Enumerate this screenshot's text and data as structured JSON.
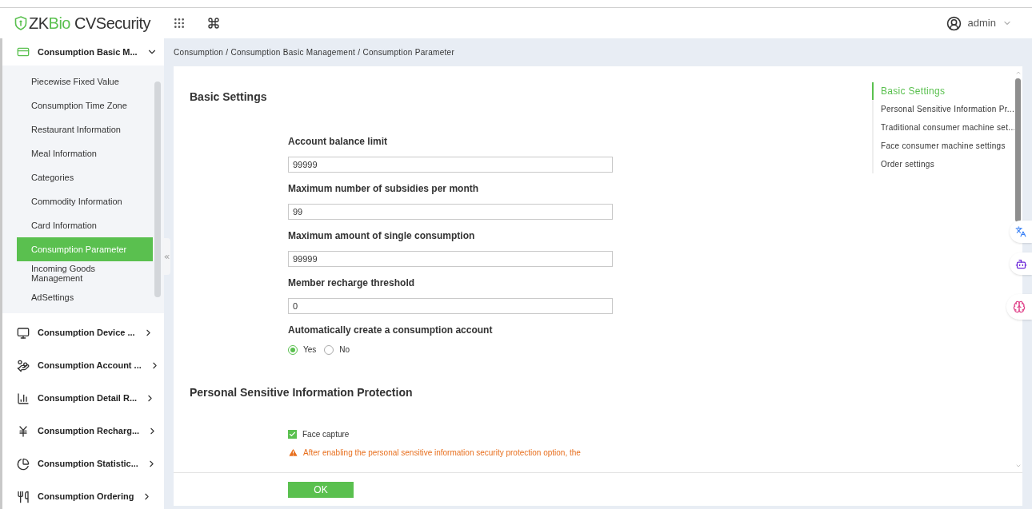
{
  "header": {
    "logo": {
      "part1": "ZK",
      "part2": "Bio",
      "part3": " CVSecurity"
    },
    "user": "admin"
  },
  "sidebar": {
    "groups": [
      {
        "label": "Consumption Basic M...",
        "expanded": true,
        "children": [
          {
            "label": "Piecewise Fixed Value",
            "selected": false
          },
          {
            "label": "Consumption Time Zone",
            "selected": false
          },
          {
            "label": "Restaurant Information",
            "selected": false
          },
          {
            "label": "Meal Information",
            "selected": false
          },
          {
            "label": "Categories",
            "selected": false
          },
          {
            "label": "Commodity Information",
            "selected": false
          },
          {
            "label": "Card Information",
            "selected": false
          },
          {
            "label": "Consumption Parameter",
            "selected": true
          },
          {
            "label": "Incoming Goods Management",
            "selected": false
          },
          {
            "label": "AdSettings",
            "selected": false
          }
        ]
      },
      {
        "label": "Consumption Device ...",
        "expanded": false
      },
      {
        "label": "Consumption Account ...",
        "expanded": false
      },
      {
        "label": "Consumption Detail R...",
        "expanded": false
      },
      {
        "label": "Consumption Recharg...",
        "expanded": false
      },
      {
        "label": "Consumption Statistic...",
        "expanded": false
      },
      {
        "label": "Consumption Ordering",
        "expanded": false
      }
    ]
  },
  "breadcrumb": "Consumption / Consumption Basic Management / Consumption Parameter",
  "sections": [
    {
      "title": "Basic Settings",
      "fields": [
        {
          "kind": "text",
          "label": "Account balance limit",
          "value": "99999"
        },
        {
          "kind": "text",
          "label": "Maximum number of subsidies per month",
          "value": "99"
        },
        {
          "kind": "text",
          "label": "Maximum amount of single consumption",
          "value": "99999"
        },
        {
          "kind": "text",
          "label": "Member recharge threshold",
          "value": "0"
        },
        {
          "kind": "radio",
          "label": "Automatically create a consumption account",
          "options": [
            {
              "label": "Yes",
              "selected": true
            },
            {
              "label": "No",
              "selected": false
            }
          ]
        }
      ]
    },
    {
      "title": "Personal Sensitive Information Protection",
      "fields": [
        {
          "kind": "checkbox",
          "label": "Face capture",
          "checked": true
        },
        {
          "kind": "warning",
          "text": "After enabling the personal sensitive information security protection option, the"
        }
      ]
    }
  ],
  "anchors": [
    {
      "label": "Basic Settings",
      "selected": true
    },
    {
      "label": "Personal Sensitive Information Pr...",
      "selected": false
    },
    {
      "label": "Traditional consumer machine set...",
      "selected": false
    },
    {
      "label": "Face consumer machine settings",
      "selected": false
    },
    {
      "label": "Order settings",
      "selected": false
    }
  ],
  "ok_button": "OK"
}
